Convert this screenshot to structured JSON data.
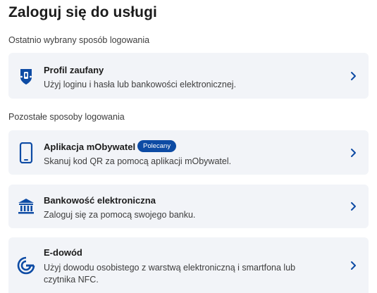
{
  "page": {
    "title": "Zaloguj się do usługi"
  },
  "recent": {
    "label": "Ostatnio wybrany sposób logowania",
    "options": [
      {
        "title": "Profil zaufany",
        "description": "Użyj loginu i hasła lub bankowości elektronicznej.",
        "icon": "trusted-profile-icon"
      }
    ]
  },
  "other": {
    "label": "Pozostałe sposoby logowania",
    "options": [
      {
        "title": "Aplikacja mObywatel",
        "badge": "Polecany",
        "description": "Skanuj kod QR za pomocą aplikacji mObywatel.",
        "icon": "smartphone-icon"
      },
      {
        "title": "Bankowość elektroniczna",
        "description": "Zaloguj się za pomocą swojego banku.",
        "icon": "bank-icon"
      },
      {
        "title": "E-dowód",
        "description": "Użyj dowodu osobistego z warstwą elektroniczną i smartfona lub czytnika NFC.",
        "icon": "nfc-id-card-icon"
      }
    ]
  },
  "colors": {
    "accent": "#0d4ba4",
    "card_background": "#f2f4f8",
    "title_text": "#1b1b1b",
    "secondary_text": "#3d3d3d"
  }
}
